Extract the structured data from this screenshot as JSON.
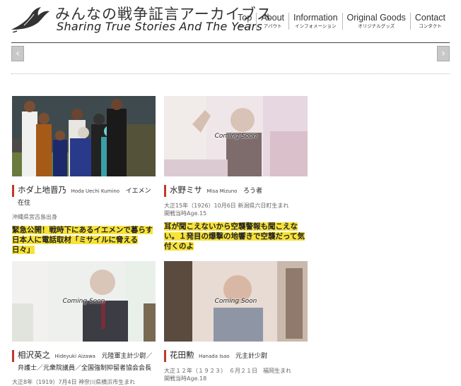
{
  "header": {
    "logo_jp": "みんなの戦争証言アーカイブス",
    "logo_en": "Sharing True Stories And The Years"
  },
  "nav": [
    {
      "en": "Top",
      "jp": "トップ"
    },
    {
      "en": "About",
      "jp": "アバウト"
    },
    {
      "en": "Information",
      "jp": "インフォメーション"
    },
    {
      "en": "Original Goods",
      "jp": "オリジナルグッズ"
    },
    {
      "en": "Contact",
      "jp": "コンタクト"
    }
  ],
  "slider": {
    "left_icon": "chevron-left-icon",
    "right_icon": "chevron-right-icon",
    "left_glyph": "‹",
    "right_glyph": "›"
  },
  "cards": [
    {
      "name_jp": "ホダ上地晋乃",
      "name_en": "Hoda Uechi Kumino",
      "role": "イエメン",
      "role2": "在住",
      "meta_lines": [
        "沖縄県宮古島出身"
      ],
      "highlight": "緊急公開！戦時下にあるイエメンで暮らす日本人に電話取材「ミサイルに脅える日々」",
      "coming_soon": ""
    },
    {
      "name_jp": "水野ミサ",
      "name_en": "Misa Mizuno",
      "role": "ろう者",
      "role2": "",
      "meta_lines": [
        "大正15年（1926）10月6日 新潟県六日町生まれ",
        "開戦当時Age.15"
      ],
      "highlight": "耳が聞こえないから空襲警報も聞こえない。１発目の爆撃の地響きで空襲だって気付くのよ",
      "coming_soon": "Coming Soon"
    },
    {
      "name_jp": "相沢英之",
      "name_en": "Hideyuki Aizawa",
      "role": "元陸軍主計少尉／",
      "role2": "弁護士／元衆院議員／全国強制抑留者協会会長",
      "meta_lines": [
        "大正8年（1919）7月4日 神奈川県横浜市生まれ"
      ],
      "highlight": "",
      "coming_soon": "Coming Soon"
    },
    {
      "name_jp": "花田勲",
      "name_en": "Hanada Isao",
      "role": "元主計少尉",
      "role2": "",
      "meta_lines": [
        "大正１２年（１９２３）　６月２１日　福岡生まれ",
        "開戦当時Age.18"
      ],
      "highlight": "",
      "coming_soon": "Coming Soon"
    }
  ],
  "colors": {
    "accent_bar": "#c0392b",
    "highlight": "#f7e23a",
    "logo_red": "#d23a3a"
  }
}
